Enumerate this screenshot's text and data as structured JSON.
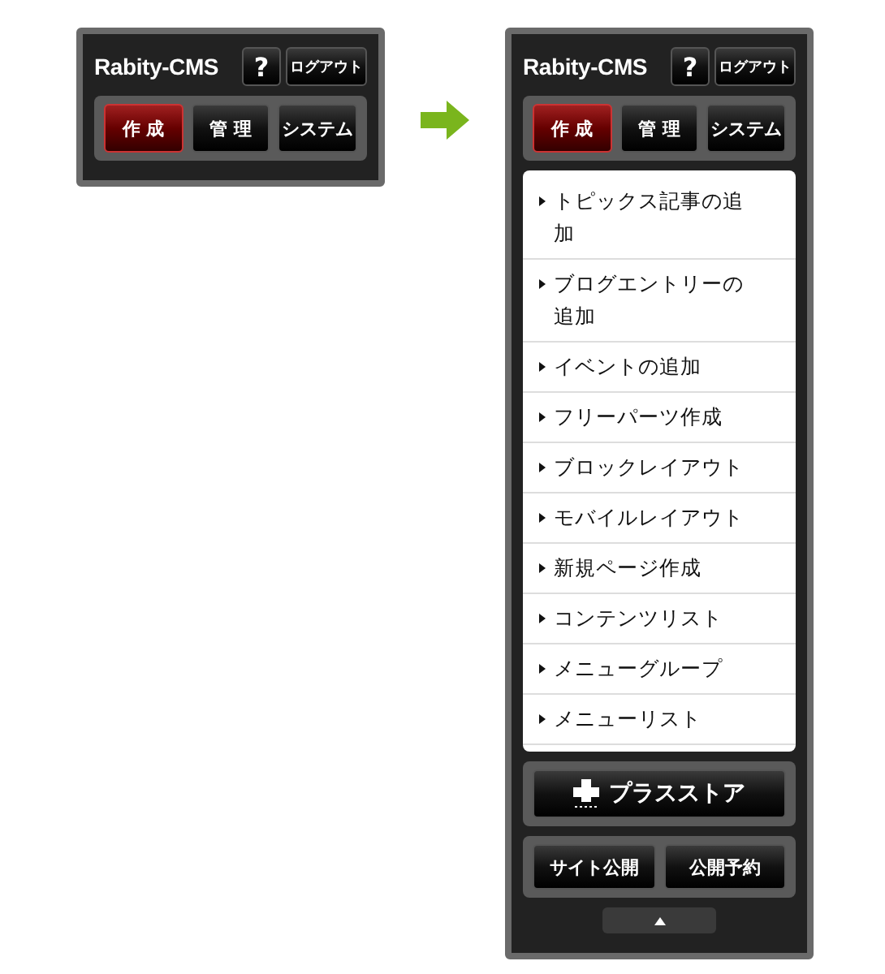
{
  "panels": [
    {
      "header": {
        "logo": "Rabity-CMS",
        "help": "?",
        "logout": "ログアウト"
      },
      "tabs": [
        {
          "label": "作 成",
          "selected": true
        },
        {
          "label": "管 理",
          "selected": false
        },
        {
          "label": "システム",
          "selected": false
        }
      ]
    },
    {
      "header": {
        "logo": "Rabity-CMS",
        "help": "?",
        "logout": "ログアウト"
      },
      "tabs": [
        {
          "label": "作 成",
          "selected": true
        },
        {
          "label": "管 理",
          "selected": false
        },
        {
          "label": "システム",
          "selected": false
        }
      ],
      "menu": [
        "トピックス記事の追加",
        "ブログエントリーの追加",
        "イベントの追加",
        "フリーパーツ作成",
        "ブロックレイアウト",
        "モバイルレイアウト",
        "新規ページ作成",
        "コンテンツリスト",
        "メニューグループ",
        "メニューリスト"
      ],
      "store_button": "プラスストア",
      "publish_buttons": [
        "サイト公開",
        "公開予約"
      ]
    }
  ]
}
